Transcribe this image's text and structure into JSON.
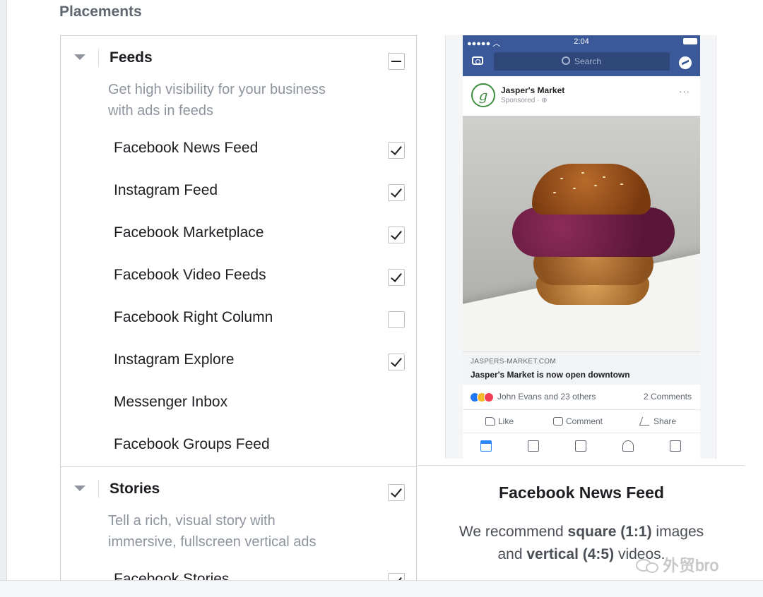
{
  "placements_title": "Placements",
  "feeds": {
    "title": "Feeds",
    "description_line1": "Get high visibility for your business",
    "description_line2": "with ads in feeds",
    "state": "mixed",
    "items": [
      {
        "label": "Facebook News Feed",
        "checked": true,
        "has_checkbox": true
      },
      {
        "label": "Instagram Feed",
        "checked": true,
        "has_checkbox": true
      },
      {
        "label": "Facebook Marketplace",
        "checked": true,
        "has_checkbox": true
      },
      {
        "label": "Facebook Video Feeds",
        "checked": true,
        "has_checkbox": true
      },
      {
        "label": "Facebook Right Column",
        "checked": false,
        "has_checkbox": true
      },
      {
        "label": "Instagram Explore",
        "checked": true,
        "has_checkbox": true
      },
      {
        "label": "Messenger Inbox",
        "checked": false,
        "has_checkbox": false
      },
      {
        "label": "Facebook Groups Feed",
        "checked": false,
        "has_checkbox": false
      }
    ]
  },
  "stories": {
    "title": "Stories",
    "description_line1": "Tell a rich, visual story with",
    "description_line2": "immersive, fullscreen vertical ads",
    "state": "checked",
    "items": [
      {
        "label": "Facebook Stories",
        "checked": true,
        "has_checkbox": true
      }
    ]
  },
  "preview": {
    "status_time": "2:04",
    "search_placeholder": "Search",
    "page_name": "Jasper's Market",
    "sponsored": "Sponsored · ⊕",
    "avatar_letter": "g",
    "more": "···",
    "link_domain": "JASPERS-MARKET.COM",
    "link_title": "Jasper's Market is now open downtown",
    "reactions_text": "John Evans and 23 others",
    "comments_count": "2 Comments",
    "like_label": "Like",
    "comment_label": "Comment",
    "share_label": "Share",
    "placement_name": "Facebook News Feed",
    "recommend_prefix": "We recommend ",
    "recommend_square": "square (1:1)",
    "recommend_images": " images",
    "recommend_and": "and ",
    "recommend_vertical": "vertical (4:5)",
    "recommend_videos": " videos."
  },
  "watermark": "外贸bro",
  "colors": {
    "facebook_blue": "#3b5998",
    "muted_text": "#8d949e",
    "border": "#ccd0d5"
  }
}
